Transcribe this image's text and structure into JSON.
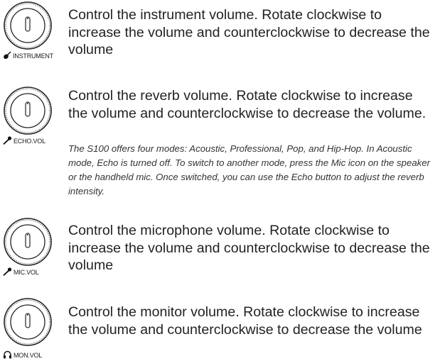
{
  "entries": [
    {
      "label": "INSTRUMENT",
      "label_icon": "guitar-icon",
      "description": "Control the instrument volume. Rotate clockwise to increase the volume and counterclockwise to decrease the volume"
    },
    {
      "label": "ECHO.VOL",
      "label_icon": "microphone-icon",
      "description": "Control the reverb volume. Rotate clockwise to increase the volume and counterclockwise to decrease the volume.",
      "note": "The S100 offers four modes: Acoustic, Professional, Pop, and Hip-Hop. In Acoustic mode, Echo is turned off. To switch to another mode, press the Mic icon on the speaker or the handheld mic. Once switched, you can use the Echo button to adjust the reverb intensity."
    },
    {
      "label": "MIC.VOL",
      "label_icon": "microphone-icon",
      "description": "Control the microphone volume. Rotate clockwise to increase the volume and counterclockwise to decrease the volume"
    },
    {
      "label": "MON.VOL",
      "label_icon": "headphones-icon",
      "description": "Control the monitor volume. Rotate clockwise to increase the volume and counterclockwise to decrease the volume"
    }
  ]
}
